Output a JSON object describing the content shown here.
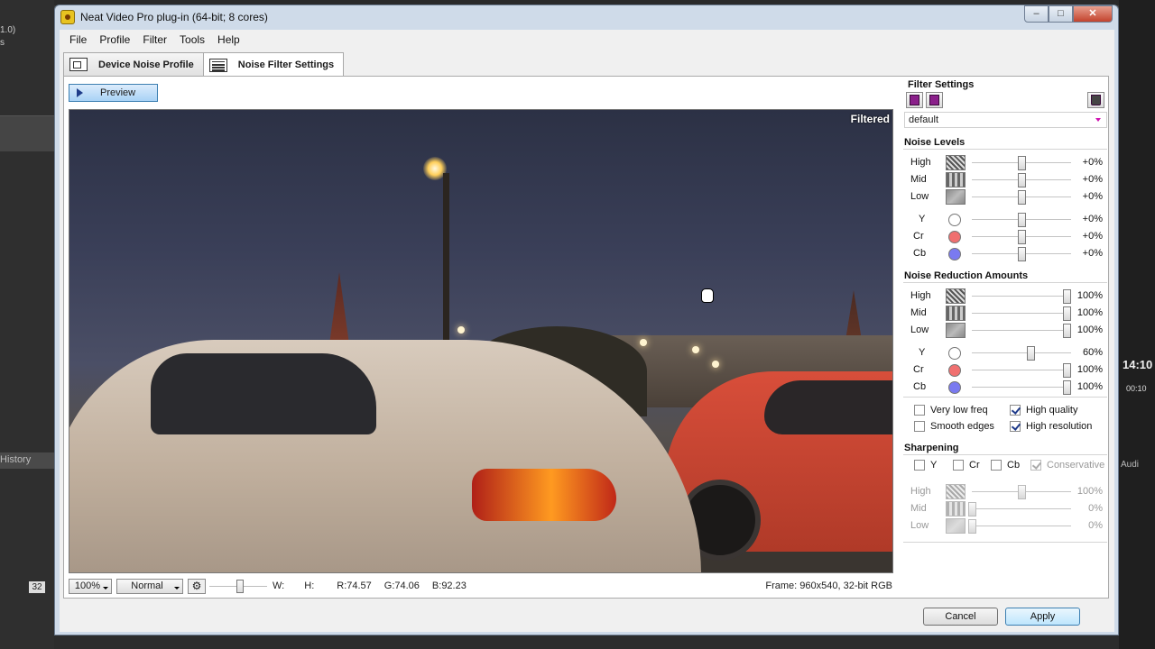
{
  "window": {
    "title": "Neat Video Pro plug-in (64-bit; 8 cores)"
  },
  "background": {
    "left_text_1": "1.0)",
    "left_text_2": "s",
    "history_label": "History",
    "badge": "32",
    "clock": "14:10",
    "clock_sub": "00:10",
    "audio_label": "Audi"
  },
  "menu": [
    "File",
    "Profile",
    "Filter",
    "Tools",
    "Help"
  ],
  "tabs": [
    {
      "label": "Device Noise Profile",
      "icon": "camera-profile-icon"
    },
    {
      "label": "Noise Filter Settings",
      "icon": "sliders-icon"
    }
  ],
  "preview_button": "Preview",
  "video": {
    "overlay_label": "Filtered"
  },
  "statusbar": {
    "zoom": "100%",
    "mode": "Normal",
    "w_label": "W:",
    "h_label": "H:",
    "r_value": "R:74.57",
    "g_value": "G:74.06",
    "b_value": "B:92.23",
    "frame_info": "Frame: 960x540, 32-bit RGB"
  },
  "filter_settings": {
    "title": "Filter Settings",
    "preset": "default",
    "noise_levels_title": "Noise Levels",
    "noise_levels": [
      {
        "label": "High",
        "value": "+0%"
      },
      {
        "label": "Mid",
        "value": "+0%"
      },
      {
        "label": "Low",
        "value": "+0%"
      },
      {
        "label": "Y",
        "value": "+0%"
      },
      {
        "label": "Cr",
        "value": "+0%"
      },
      {
        "label": "Cb",
        "value": "+0%"
      }
    ],
    "noise_reduction_title": "Noise Reduction Amounts",
    "noise_reduction": [
      {
        "label": "High",
        "value": "100%"
      },
      {
        "label": "Mid",
        "value": "100%"
      },
      {
        "label": "Low",
        "value": "100%"
      },
      {
        "label": "Y",
        "value": "60%"
      },
      {
        "label": "Cr",
        "value": "100%"
      },
      {
        "label": "Cb",
        "value": "100%"
      }
    ],
    "options": [
      {
        "label": "Very low freq",
        "checked": false
      },
      {
        "label": "High quality",
        "checked": true
      },
      {
        "label": "Smooth edges",
        "checked": false
      },
      {
        "label": "High resolution",
        "checked": true
      }
    ],
    "sharpening_title": "Sharpening",
    "sharpening_channels": [
      {
        "label": "Y",
        "checked": false
      },
      {
        "label": "Cr",
        "checked": false
      },
      {
        "label": "Cb",
        "checked": false
      },
      {
        "label": "Conservative",
        "checked": true
      }
    ],
    "sharpening": [
      {
        "label": "High",
        "value": "100%"
      },
      {
        "label": "Mid",
        "value": "0%"
      },
      {
        "label": "Low",
        "value": "0%"
      }
    ]
  },
  "colors": {
    "cr": "#f07070",
    "cb": "#7a7af0",
    "y": "#ffffff"
  },
  "buttons": {
    "cancel": "Cancel",
    "apply": "Apply"
  }
}
